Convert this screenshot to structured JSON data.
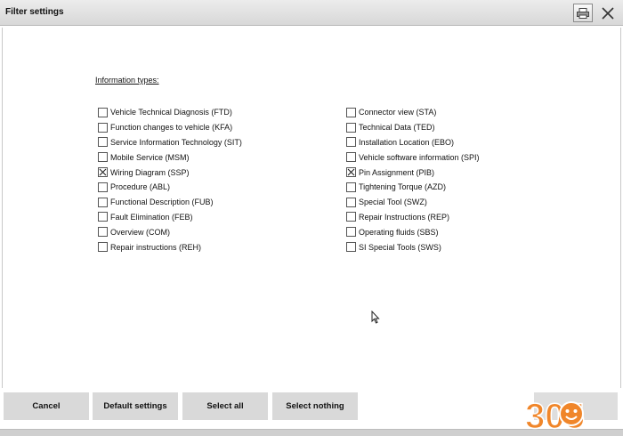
{
  "window": {
    "title": "Filter settings"
  },
  "section": {
    "label": "Information types:"
  },
  "left_items": [
    {
      "label": "Vehicle Technical Diagnosis (FTD)",
      "checked": false
    },
    {
      "label": "Function changes to vehicle (KFA)",
      "checked": false
    },
    {
      "label": "Service Information Technology (SIT)",
      "checked": false
    },
    {
      "label": "Mobile Service (MSM)",
      "checked": false
    },
    {
      "label": "Wiring Diagram (SSP)",
      "checked": true
    },
    {
      "label": "Procedure (ABL)",
      "checked": false
    },
    {
      "label": "Functional Description (FUB)",
      "checked": false
    },
    {
      "label": "Fault Elimination (FEB)",
      "checked": false
    },
    {
      "label": "Overview (COM)",
      "checked": false
    },
    {
      "label": "Repair instructions (REH)",
      "checked": false
    }
  ],
  "right_items": [
    {
      "label": "Connector view (STA)",
      "checked": false
    },
    {
      "label": "Technical Data (TED)",
      "checked": false
    },
    {
      "label": "Installation Location (EBO)",
      "checked": false
    },
    {
      "label": "Vehicle software information (SPI)",
      "checked": false
    },
    {
      "label": "Pin Assignment (PIB)",
      "checked": true
    },
    {
      "label": "Tightening Torque (AZD)",
      "checked": false
    },
    {
      "label": "Special Tool (SWZ)",
      "checked": false
    },
    {
      "label": "Repair Instructions (REP)",
      "checked": false
    },
    {
      "label": "Operating fluids (SBS)",
      "checked": false
    },
    {
      "label": "SI Special Tools (SWS)",
      "checked": false
    }
  ],
  "buttons": {
    "cancel": "Cancel",
    "default_settings": "Default settings",
    "select_all": "Select all",
    "select_nothing": "Select nothing"
  },
  "watermark": {
    "text": "305"
  },
  "colors": {
    "button_bg": "#d9d9d9",
    "logo_orange": "#f0862a"
  }
}
